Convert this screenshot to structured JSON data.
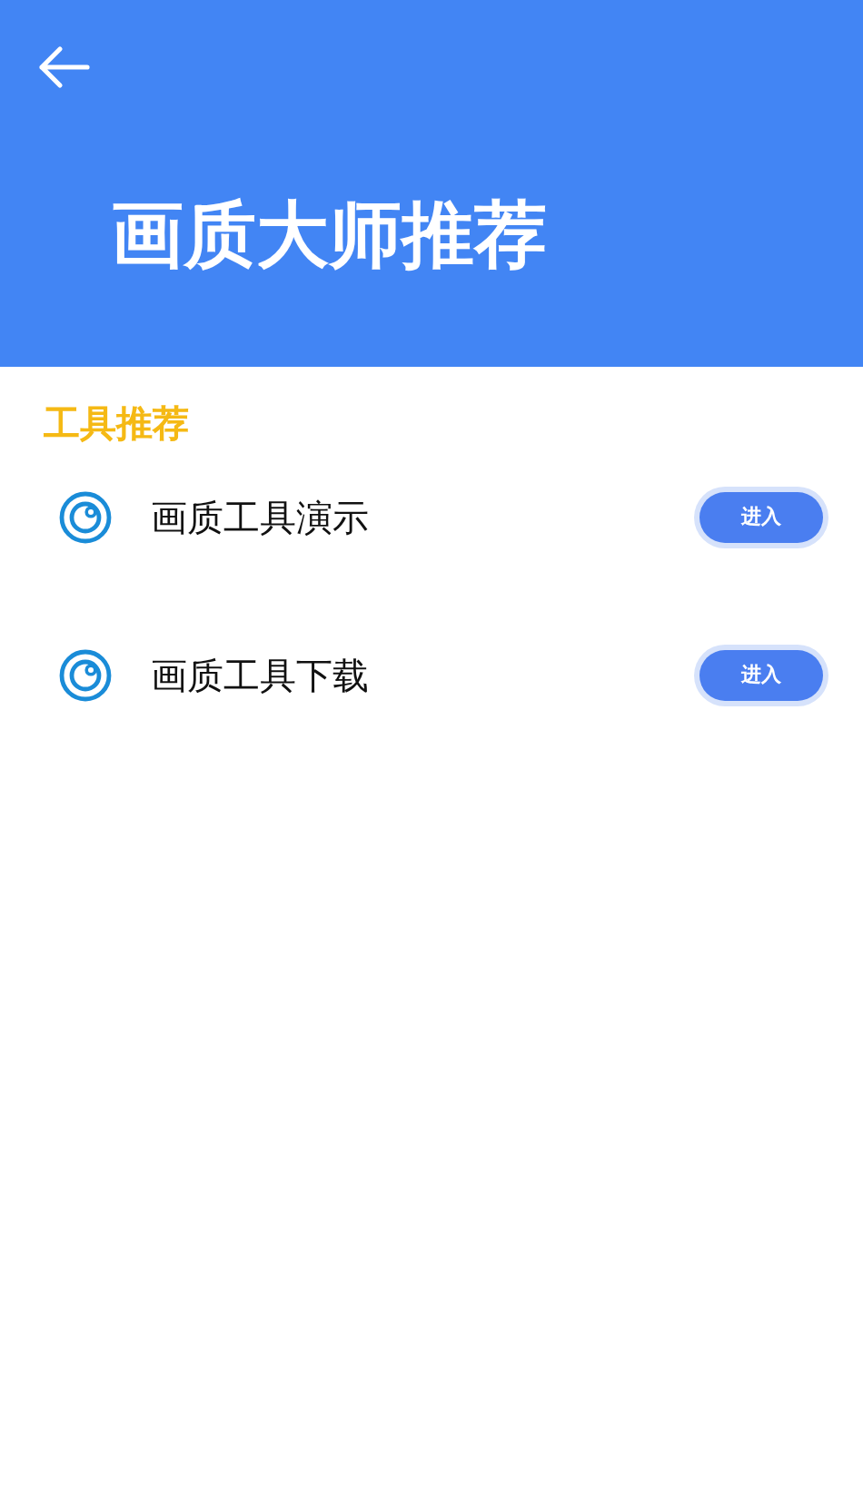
{
  "header": {
    "title": "画质大师推荐"
  },
  "section": {
    "title": "工具推荐"
  },
  "tools": [
    {
      "label": "画质工具演示",
      "button": "进入"
    },
    {
      "label": "画质工具下载",
      "button": "进入"
    }
  ]
}
